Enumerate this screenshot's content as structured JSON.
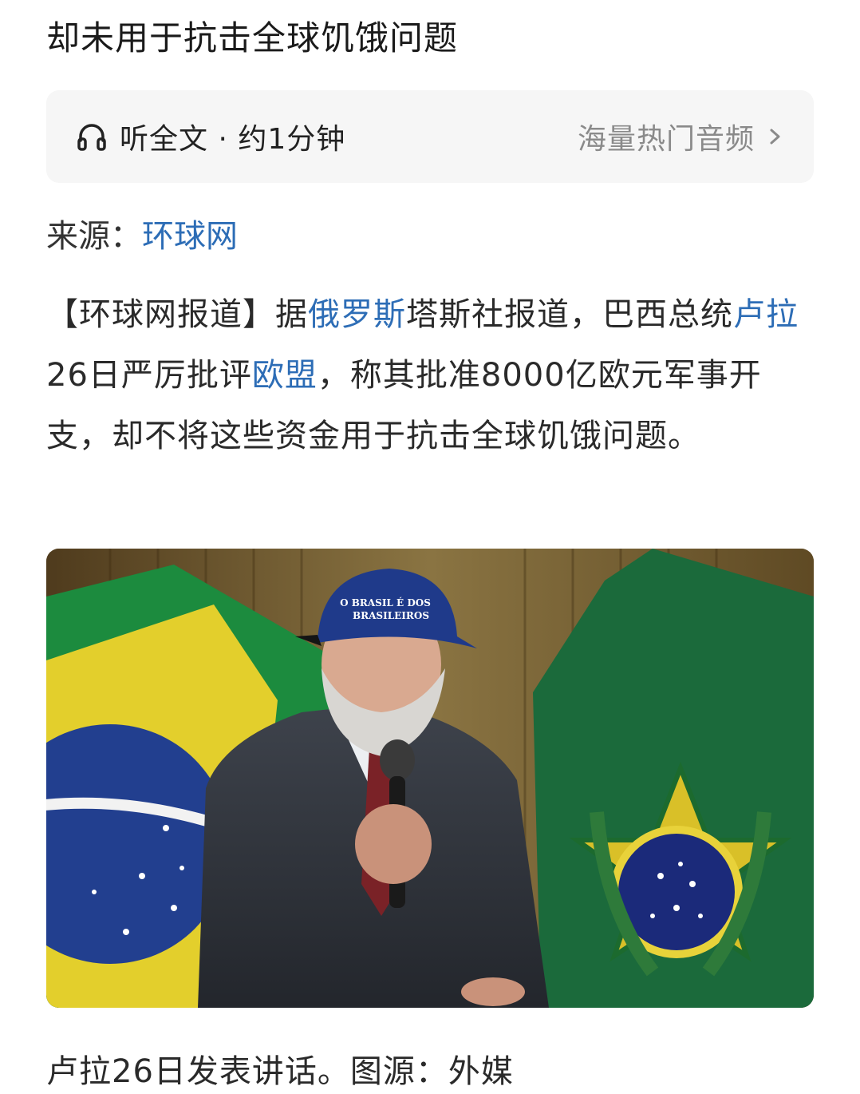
{
  "article": {
    "title_line": "却未用于抗击全球饥饿问题",
    "audio": {
      "listen_label": "听全文 · 约1分钟",
      "hot_audio_label": "海量热门音频",
      "headphone_icon": "headphone-icon",
      "chevron_icon": "chevron-right-icon"
    },
    "source": {
      "label": "来源：",
      "name": "环球网",
      "link_color": "#2d6db6"
    },
    "body": {
      "p1_a": "【环球网报道】据",
      "p1_link_russia": "俄罗斯",
      "p1_b": "塔斯社报道，巴西总统",
      "p1_link_lula": "卢拉",
      "p1_c": "26日严厉批评",
      "p1_link_eu": "欧盟",
      "p1_d": "，称其批准8000亿欧元军事开支，却不将这些资金用于抗击全球饥饿问题。"
    },
    "photo": {
      "cap_text_line1": "O BRASIL É DOS",
      "cap_text_line2": "BRASILEIROS"
    },
    "caption": "卢拉26日发表讲话。图源：外媒"
  }
}
